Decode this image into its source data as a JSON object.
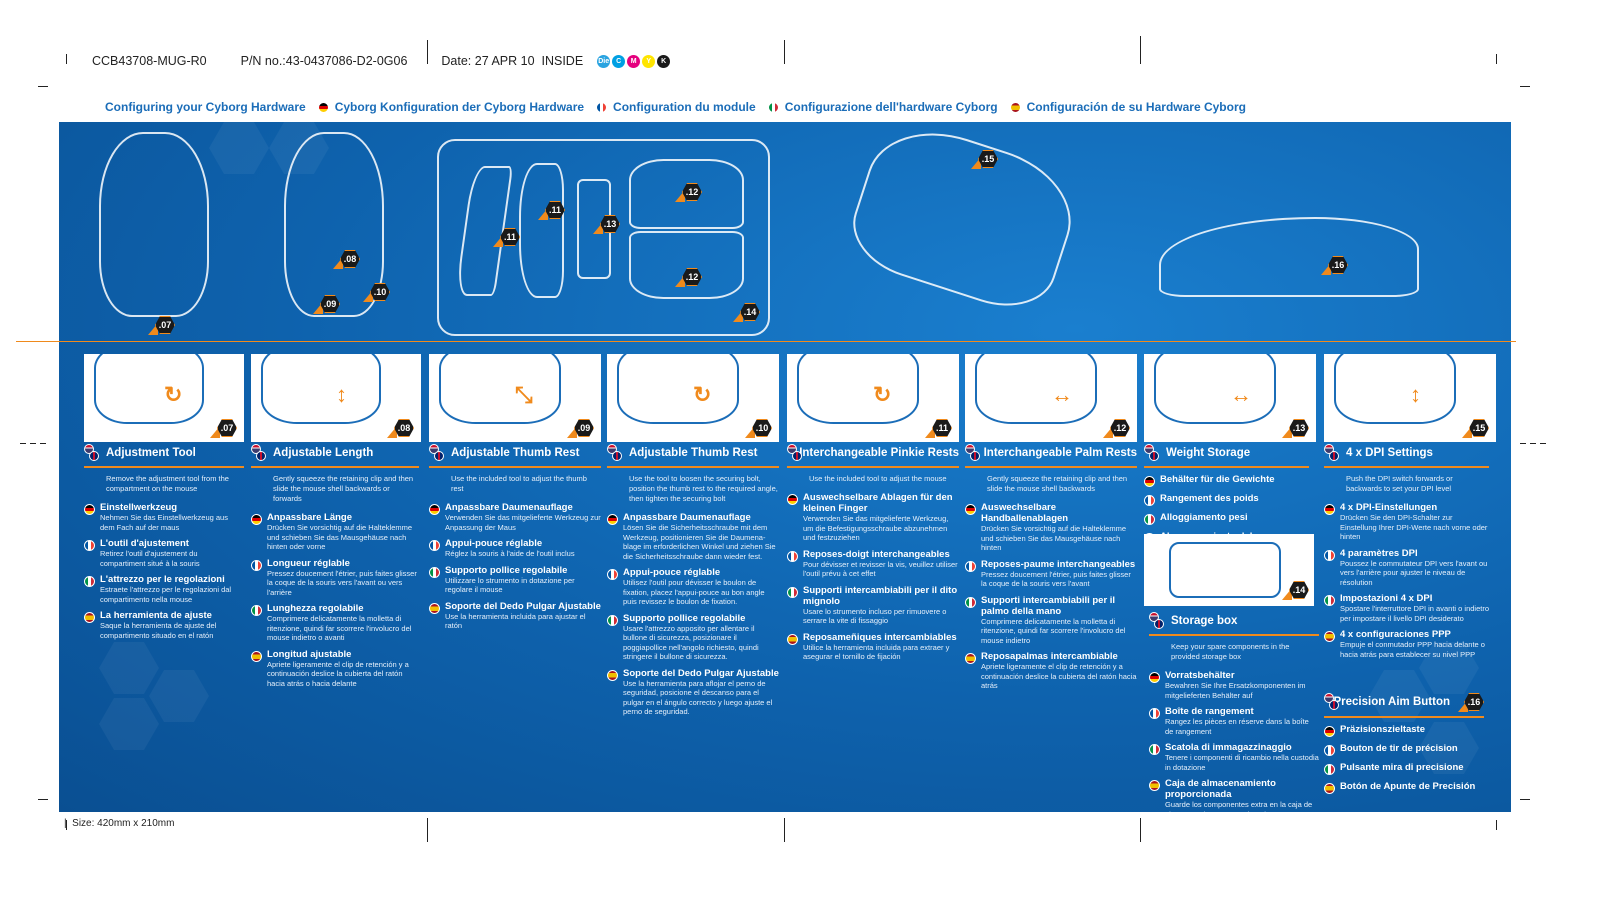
{
  "print_meta": {
    "job_code": "CCB43708-MUG-R0",
    "part_number": "P/N no.:43-0437086-D2-0G06",
    "date": "Date: 27 APR 10",
    "side": "INSIDE",
    "inks": [
      {
        "label": "Die",
        "color": "#29a3e0"
      },
      {
        "label": "C",
        "color": "#00a0e3"
      },
      {
        "label": "M",
        "color": "#e5007e"
      },
      {
        "label": "Y",
        "color": "#ffe500"
      },
      {
        "label": "K",
        "color": "#1a1a1a"
      }
    ],
    "size": "Size: 420mm x 210mm"
  },
  "header_titles": [
    {
      "lang": "en",
      "text": "Configuring your Cyborg Hardware"
    },
    {
      "lang": "de",
      "text": "Cyborg Konfiguration der Cyborg Hardware"
    },
    {
      "lang": "fr",
      "text": "Configuration du module"
    },
    {
      "lang": "it",
      "text": "Configurazione dell'hardware Cyborg"
    },
    {
      "lang": "es",
      "text": "Configuración de su Hardware Cyborg"
    }
  ],
  "colors": {
    "brand_blue": "#0e62ad",
    "accent_orange": "#f08a1c",
    "title_blue": "#1b6db8"
  },
  "hero_badges": [
    ".07",
    ".08",
    ".09",
    ".10",
    ".11",
    ".11",
    ".13",
    ".12",
    ".12",
    ".14",
    ".15",
    ".16"
  ],
  "panel_badges": [
    ".07",
    ".08",
    ".09",
    ".10",
    ".11",
    ".12",
    ".13",
    ".15"
  ],
  "storage_badge": ".14",
  "sections": [
    {
      "title": "Adjustment Tool",
      "en": "Remove the adjustment tool from the compartment on the mouse",
      "langs": [
        {
          "lang": "de",
          "title": "Einstellwerkzeug",
          "desc": "Nehmen Sie das Einstellwerkzeug aus dem Fach auf der maus"
        },
        {
          "lang": "fr",
          "title": "L'outil d'ajustement",
          "desc": "Retirez l'outil d'ajustement du compartiment situé à la souris"
        },
        {
          "lang": "it",
          "title": "L'attrezzo per le regolazioni",
          "desc": "Estraete l'attrezzo per le regolazioni dal compartimento nella mouse"
        },
        {
          "lang": "es",
          "title": "La herramienta de ajuste",
          "desc": "Saque la herramienta de ajuste del compartimento situado en el ratón"
        }
      ]
    },
    {
      "title": "Adjustable Length",
      "en": "Gently squeeze the retaining clip and then slide the mouse shell backwards or forwards",
      "langs": [
        {
          "lang": "de",
          "title": "Anpassbare Länge",
          "desc": "Drücken Sie vorsichtig auf die Halteklemme und schieben Sie das Mausgehäuse nach hinten oder vorne"
        },
        {
          "lang": "fr",
          "title": "Longueur réglable",
          "desc": "Pressez doucement l'étrier, puis faites glisser la coque de la souris vers l'avant ou vers l'arrière"
        },
        {
          "lang": "it",
          "title": "Lunghezza regolabile",
          "desc": "Comprimere delicatamente la molletta di ritenzione, quindi far scorrere l'involucro del mouse indietro o avanti"
        },
        {
          "lang": "es",
          "title": "Longitud ajustable",
          "desc": "Apriete ligeramente el clip de retención y a continuación deslice la cubierta del ratón hacia atrás o hacia delante"
        }
      ]
    },
    {
      "title": "Adjustable Thumb Rest",
      "en": "Use the included tool to adjust the thumb rest",
      "langs": [
        {
          "lang": "de",
          "title": "Anpassbare Daumenauflage",
          "desc": "Verwenden Sie das mitgelieferte Werkzeug zur Anpassung der Maus"
        },
        {
          "lang": "fr",
          "title": "Appui-pouce réglable",
          "desc": "Réglez la souris à l'aide de l'outil inclus"
        },
        {
          "lang": "it",
          "title": "Supporto pollice regolabile",
          "desc": "Utilizzare lo strumento in dotazione per regolare il mouse"
        },
        {
          "lang": "es",
          "title": "Soporte del Dedo Pulgar Ajustable",
          "desc": "Use la herramienta incluida para ajustar el ratón"
        }
      ]
    },
    {
      "title": "Adjustable Thumb Rest",
      "en": "Use the tool to loosen the securing bolt, position the thumb rest to the required angle, then tighten the securing bolt",
      "langs": [
        {
          "lang": "de",
          "title": "Anpassbare Daumenauflage",
          "desc": "Lösen Sie die Sicherheitsschraube mit dem Werkzeug, positionieren Sie die Daumena-blage im erforderlichen Winkel und ziehen Sie die Sicherheitsschraube dann wieder fest."
        },
        {
          "lang": "fr",
          "title": "Appui-pouce réglable",
          "desc": "Utilisez l'outil pour dévisser le boulon de fixation, placez l'appui-pouce au bon angle puis revissez le boulon de fixation."
        },
        {
          "lang": "it",
          "title": "Supporto pollice regolabile",
          "desc": "Usare l'attrezzo apposito per allentare il bullone di sicurezza, posizionare il poggiapollice nell'angolo richiesto, quindi stringere il bullone di sicurezza."
        },
        {
          "lang": "es",
          "title": "Soporte del Dedo Pulgar Ajustable",
          "desc": "Use la herramienta para aflojar el perno de seguridad, posicione el descanso para el pulgar en el ángulo correcto y luego ajuste el perno de seguridad."
        }
      ]
    },
    {
      "title": "Interchangeable Pinkie Rests",
      "en": "Use the included tool to adjust the mouse",
      "langs": [
        {
          "lang": "de",
          "title": "Auswechselbare Ablagen für den kleinen Finger",
          "desc": "Verwenden Sie das mitgelieferte Werkzeug, um die Befestigungsschraube abzunehmen und festzuziehen"
        },
        {
          "lang": "fr",
          "title": "Reposes-doigt interchangeables",
          "desc": "Pour dévisser et revisser la vis, veuillez utiliser l'outil prévu à cet effet"
        },
        {
          "lang": "it",
          "title": "Supporti intercambiabili per il dito mignolo",
          "desc": "Usare lo strumento incluso per rimuovere o serrare la vite di fissaggio"
        },
        {
          "lang": "es",
          "title": "Reposameñiques intercambiables",
          "desc": "Utilice la herramienta incluida para extraer y asegurar el tornillo de fijación"
        }
      ]
    },
    {
      "title": "Interchangeable Palm Rests",
      "en": "Gently squeeze the retaining clip and then slide the mouse shell backwards",
      "langs": [
        {
          "lang": "de",
          "title": "Auswechselbare Handballenablagen",
          "desc": "Drücken Sie vorsichtig auf die Halteklemme und schieben Sie das Mausgehäuse nach hinten"
        },
        {
          "lang": "fr",
          "title": "Reposes-paume interchangeables",
          "desc": "Pressez doucement l'étrier, puis faites glisser la coque de la souris vers l'avant"
        },
        {
          "lang": "it",
          "title": "Supporti intercambiabili per il palmo della mano",
          "desc": "Comprimere delicatamente la molletta di ritenzione, quindi far scorrere l'involucro del mouse indietro"
        },
        {
          "lang": "es",
          "title": "Reposapalmas intercambiable",
          "desc": "Apriete ligeramente el clip de retención y a continuación deslice la cubierta del ratón hacia atrás"
        }
      ]
    },
    {
      "title": "Weight Storage",
      "en": "",
      "langs": [
        {
          "lang": "de",
          "title": "Behälter für die Gewichte",
          "desc": ""
        },
        {
          "lang": "fr",
          "title": "Rangement des poids",
          "desc": ""
        },
        {
          "lang": "it",
          "title": "Alloggiamento pesi",
          "desc": ""
        },
        {
          "lang": "es",
          "title": "Almacenamiento del peso",
          "desc": ""
        }
      ]
    },
    {
      "title": "4 x DPI Settings",
      "en": "Push the DPI switch forwards or backwards to set your DPI level",
      "langs": [
        {
          "lang": "de",
          "title": "4 x DPI-Einstellungen",
          "desc": "Drücken Sie den DPI-Schalter zur Einstellung Ihrer DPI-Werte nach vorne oder hinten"
        },
        {
          "lang": "fr",
          "title": "4 paramètres DPI",
          "desc": "Poussez le commutateur DPI vers l'avant ou vers l'arrière pour ajuster le niveau de résolution"
        },
        {
          "lang": "it",
          "title": "Impostazioni 4 x DPI",
          "desc": "Spostare l'interruttore DPI in avanti o indietro per impostare il livello DPI desiderato"
        },
        {
          "lang": "es",
          "title": "4 x configuraciones PPP",
          "desc": "Empuje el conmutador PPP hacia delante o hacia atrás para establecer su nivel PPP"
        }
      ]
    }
  ],
  "storage_box": {
    "title": "Storage box",
    "en": "Keep your spare components in the provided storage box",
    "langs": [
      {
        "lang": "de",
        "title": "Vorratsbehälter",
        "desc": "Bewahren Sie Ihre Ersatzkomponenten im mitgelieferten Behälter auf"
      },
      {
        "lang": "fr",
        "title": "Boîte de rangement",
        "desc": "Rangez les pièces en réserve dans la boîte de rangement"
      },
      {
        "lang": "it",
        "title": "Scatola di immagazzinaggio",
        "desc": "Tenere i componenti di ricambio nella custodia in dotazione"
      },
      {
        "lang": "es",
        "title": "Caja de almacenamiento proporcionada",
        "desc": "Guarde los componentes extra en la caja de almacenamiento proporcionada"
      }
    ]
  },
  "precision_aim": {
    "title": "Precision Aim Button",
    "badge": ".16",
    "langs": [
      {
        "lang": "de",
        "title": "Präzisionszieltaste",
        "desc": ""
      },
      {
        "lang": "fr",
        "title": "Bouton de tir de précision",
        "desc": ""
      },
      {
        "lang": "it",
        "title": "Pulsante mira di precisione",
        "desc": ""
      },
      {
        "lang": "es",
        "title": "Botón de Apunte de Precisión",
        "desc": ""
      }
    ]
  }
}
